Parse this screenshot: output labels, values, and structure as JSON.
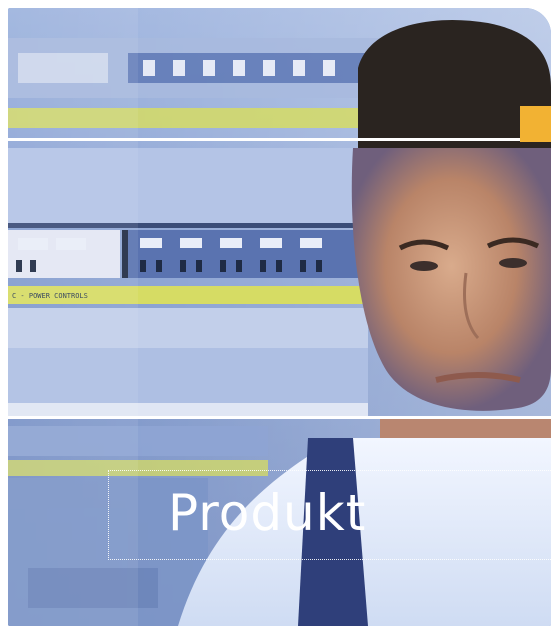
{
  "label": {
    "text": "Produkt"
  },
  "panel_text": {
    "text": "C - POWER CONTROLS"
  },
  "colors": {
    "accent_orange": "#f2b233",
    "panel_blue": "#8aa6d6",
    "panel_yellow": "#d6dc64",
    "skin": "#c99a7e",
    "white": "#ffffff"
  }
}
